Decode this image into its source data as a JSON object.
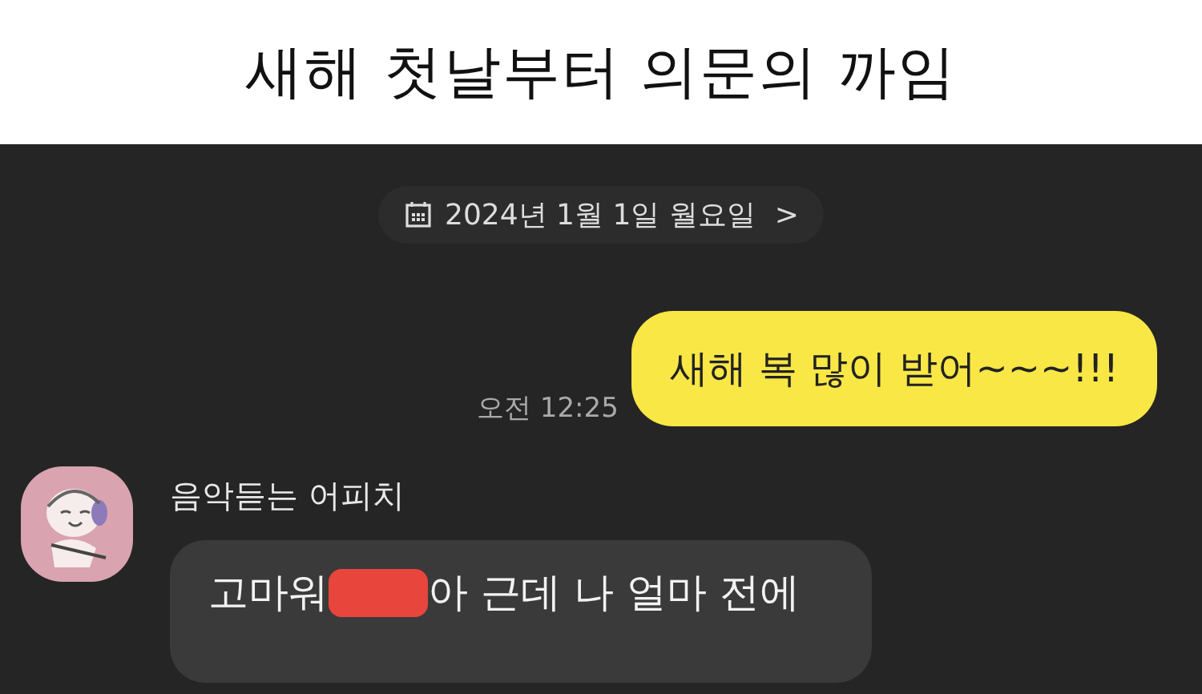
{
  "title": "새해 첫날부터 의문의 까임",
  "chat": {
    "date": "2024년 1월 1일 월요일",
    "date_arrow": ">",
    "messages": [
      {
        "kind": "sent",
        "text": "새해 복 많이 받어~~~!!!",
        "time": "오전 12:25"
      },
      {
        "kind": "received",
        "sender": "음악듣는 어피치",
        "parts": [
          {
            "kind": "text",
            "text": "고마워"
          },
          {
            "kind": "redacted"
          },
          {
            "kind": "text",
            "text": "아 근데 나 얼마 전에"
          }
        ]
      }
    ]
  }
}
